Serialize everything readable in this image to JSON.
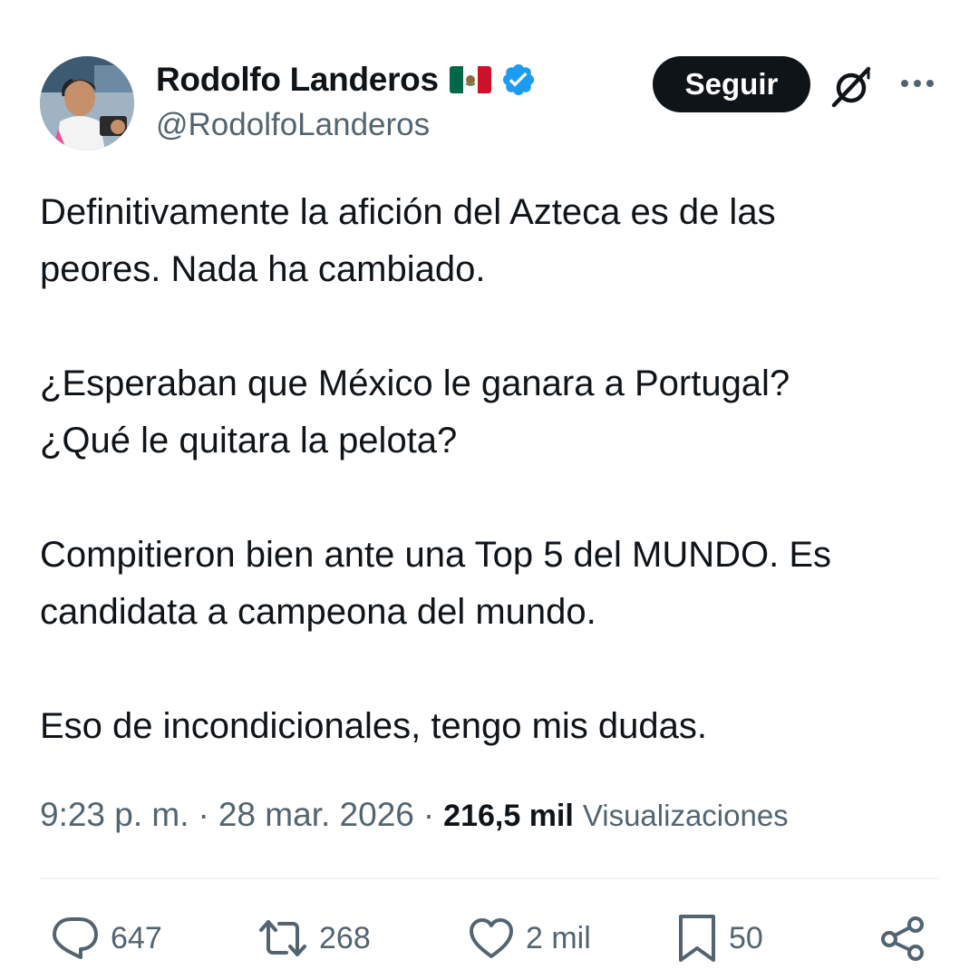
{
  "author": {
    "display_name": "Rodolfo Landeros",
    "flag_icon": "mexico-flag-icon",
    "verified_icon": "verified-badge-icon",
    "handle": "@RodolfoLanderos"
  },
  "header": {
    "follow_label": "Seguir",
    "grok_icon": "grok-icon",
    "more_icon": "more-options-icon"
  },
  "tweet": {
    "paragraphs": [
      [
        "Definitivamente la afición del Azteca es de las",
        "peores. Nada ha cambiado."
      ],
      [
        "¿Esperaban que México le ganara a Portugal?",
        "¿Qué le quitara la pelota?"
      ],
      [
        "Compitieron bien ante una Top 5 del MUNDO. Es",
        "candidata a campeona del mundo."
      ],
      [
        "Eso de incondicionales, tengo mis dudas."
      ]
    ]
  },
  "meta": {
    "time": "9:23 p. m.",
    "separator": "·",
    "date": "28 mar. 2026",
    "views_count": "216,5 mil",
    "views_label": "Visualizaciones"
  },
  "actions": {
    "replies": "647",
    "reposts": "268",
    "likes": "2 mil",
    "bookmarks": "50"
  },
  "colors": {
    "text_primary": "#0f1419",
    "text_secondary": "#536471",
    "verified_blue": "#1d9bf0",
    "divider": "#eff3f4"
  }
}
